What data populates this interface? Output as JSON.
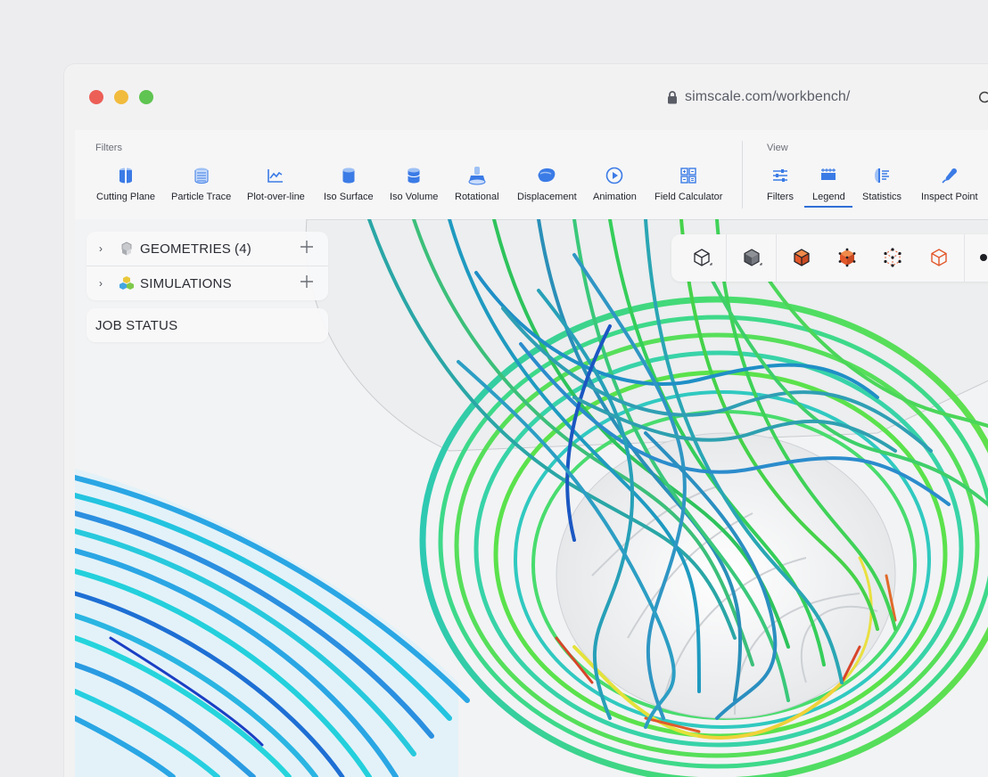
{
  "browser": {
    "url": "simscale.com/workbench/"
  },
  "toolbar": {
    "filters_label": "Filters",
    "view_label": "View",
    "filters": [
      {
        "label": "Cutting Plane",
        "icon": "cutting-plane-icon"
      },
      {
        "label": "Particle Trace",
        "icon": "particle-trace-icon"
      },
      {
        "label": "Plot-over-line",
        "icon": "plot-over-line-icon"
      },
      {
        "label": "Iso Surface",
        "icon": "iso-surface-icon"
      },
      {
        "label": "Iso Volume",
        "icon": "iso-volume-icon"
      },
      {
        "label": "Rotational",
        "icon": "rotational-icon"
      },
      {
        "label": "Displacement",
        "icon": "displacement-icon"
      },
      {
        "label": "Animation",
        "icon": "animation-icon"
      },
      {
        "label": "Field Calculator",
        "icon": "field-calculator-icon"
      }
    ],
    "view": [
      {
        "label": "Filters",
        "icon": "filters-sliders-icon"
      },
      {
        "label": "Legend",
        "icon": "legend-icon",
        "active": true
      },
      {
        "label": "Statistics",
        "icon": "statistics-icon"
      },
      {
        "label": "Inspect Point",
        "icon": "inspect-point-icon"
      }
    ]
  },
  "tree": {
    "geometries": "GEOMETRIES",
    "geometries_count": "(4)",
    "simulations": "SIMULATIONS",
    "job_status": "JOB STATUS"
  },
  "view_toolbar": {
    "buttons": [
      "cube-outline-icon",
      "cube-solid-icon",
      "cube-surface-edges-icon",
      "cube-surface-icon",
      "cube-points-icon",
      "cube-wireframe-icon"
    ]
  },
  "colors": {
    "accent": "#2f6fd6",
    "icon_blue": "#3b7be6",
    "orange": "#e2582a"
  }
}
